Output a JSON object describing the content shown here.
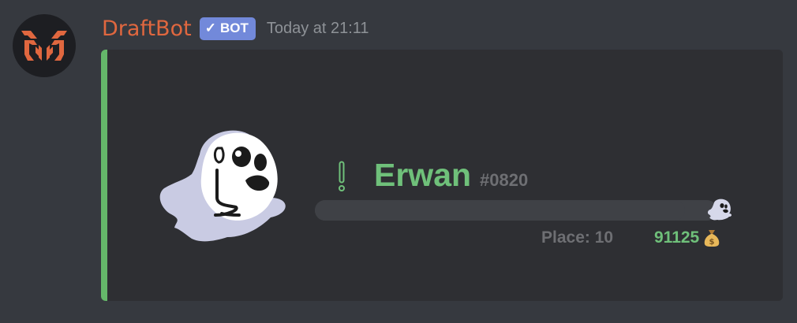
{
  "message": {
    "author": "DraftBot",
    "bot_tag": {
      "check": "✓",
      "label": "BOT"
    },
    "timestamp": "Today at 21:11"
  },
  "embed": {
    "accent_color": "#65b76a",
    "status_icon": "exclamation-icon",
    "username": "Erwan",
    "discriminator": "#0820",
    "progress": 0.92,
    "progress_icon": "ghost-icon",
    "place": "Place: 10",
    "money": "91125",
    "money_icon": "money-bag-icon",
    "colors": {
      "username": "#6fc07a",
      "author": "#e0673f",
      "bot_tag": "#7289da"
    }
  }
}
